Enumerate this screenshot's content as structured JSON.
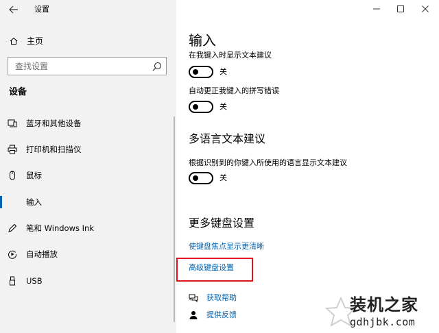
{
  "window": {
    "title": "设置",
    "back_icon": "back-arrow-icon",
    "controls": [
      "minimize-icon",
      "maximize-icon",
      "close-icon"
    ]
  },
  "sidebar": {
    "home_label": "主页",
    "search_placeholder": "查找设置",
    "section_heading": "设备",
    "items": [
      {
        "label": "蓝牙和其他设备",
        "icon": "bluetooth-devices-icon",
        "selected": false
      },
      {
        "label": "打印机和扫描仪",
        "icon": "printer-icon",
        "selected": false
      },
      {
        "label": "鼠标",
        "icon": "mouse-icon",
        "selected": false
      },
      {
        "label": "输入",
        "icon": "keyboard-icon",
        "selected": true
      },
      {
        "label": "笔和 Windows Ink",
        "icon": "pen-icon",
        "selected": false
      },
      {
        "label": "自动播放",
        "icon": "autoplay-icon",
        "selected": false
      },
      {
        "label": "USB",
        "icon": "usb-icon",
        "selected": false
      }
    ],
    "accent_color": "#0063b1"
  },
  "main": {
    "title": "输入",
    "settings": [
      {
        "description": "在我键入时显示文本建议",
        "state": "关"
      },
      {
        "description": "自动更正我键入的拼写错误",
        "state": "关"
      }
    ],
    "multilingual": {
      "title": "多语言文本建议",
      "description": "根据识别到的你键入所使用的语言显示文本建议",
      "state": "关"
    },
    "more_keyboard": {
      "title": "更多键盘设置",
      "links": [
        "使键盘焦点显示更清晰",
        "高级键盘设置"
      ]
    },
    "help": {
      "get_help": "获取帮助",
      "feedback": "提供反馈"
    },
    "highlight_color": "#e0131b"
  },
  "watermark": {
    "text": "装机之家",
    "url": "gdhjbk.com"
  }
}
